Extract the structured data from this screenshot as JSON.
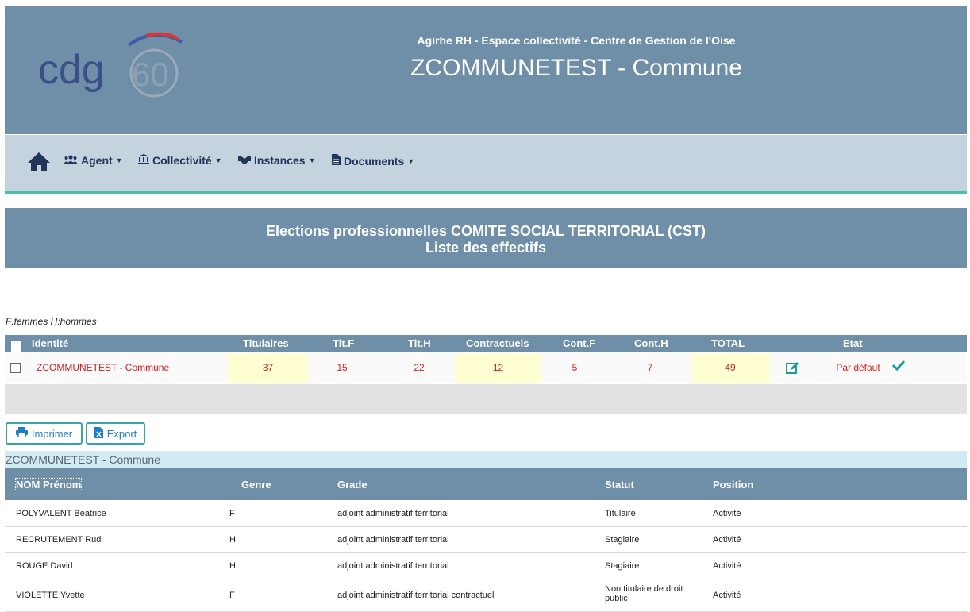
{
  "header": {
    "logo_text": "cdg",
    "logo_number": "60",
    "subtitle": "Agirhe RH - Espace collectivité - Centre de Gestion de l'Oise",
    "title": "ZCOMMUNETEST - Commune"
  },
  "nav": {
    "items": [
      {
        "label": "Agent",
        "icon": "users-icon"
      },
      {
        "label": "Collectivité",
        "icon": "institution-icon"
      },
      {
        "label": "Instances",
        "icon": "handshake-icon"
      },
      {
        "label": "Documents",
        "icon": "file-icon"
      }
    ]
  },
  "banner": {
    "line1": "Elections professionnelles COMITE SOCIAL TERRITORIAL (CST)",
    "line2": "Liste des effectifs"
  },
  "legend": "F:femmes H:hommes",
  "summary": {
    "headers": [
      "Identité",
      "Titulaires",
      "Tit.F",
      "Tit.H",
      "Contractuels",
      "Cont.F",
      "Cont.H",
      "TOTAL",
      "Etat"
    ],
    "row": {
      "identite": "ZCOMMUNETEST - Commune",
      "titulaires": "37",
      "tit_f": "15",
      "tit_h": "22",
      "contractuels": "12",
      "cont_f": "5",
      "cont_h": "7",
      "total": "49",
      "etat": "Par défaut"
    }
  },
  "buttons": {
    "print": "Imprimer",
    "export": "Export"
  },
  "group_label": "ZCOMMUNETEST - Commune",
  "detail": {
    "headers": [
      "NOM Prénom",
      "Genre",
      "Grade",
      "Statut",
      "Position"
    ],
    "rows": [
      {
        "name": "POLYVALENT Beatrice",
        "genre": "F",
        "grade": "adjoint administratif territorial",
        "statut": "Titulaire",
        "position": "Activité"
      },
      {
        "name": "RECRUTEMENT Rudi",
        "genre": "H",
        "grade": "adjoint administratif territorial",
        "statut": "Stagiaire",
        "position": "Activité"
      },
      {
        "name": "ROUGE David",
        "genre": "H",
        "grade": "adjoint administratif territorial",
        "statut": "Stagiaire",
        "position": "Activité"
      },
      {
        "name": "VIOLETTE Yvette",
        "genre": "F",
        "grade": "adjoint administratif territorial contractuel",
        "statut": "Non titulaire de droit public",
        "position": "Activité"
      }
    ]
  },
  "colors": {
    "header_bg": "#6f8ea8",
    "nav_bg": "#c5d3df",
    "accent_teal": "#4cbfae",
    "value_red": "#d42020",
    "highlight_yellow": "#ffffd2"
  }
}
